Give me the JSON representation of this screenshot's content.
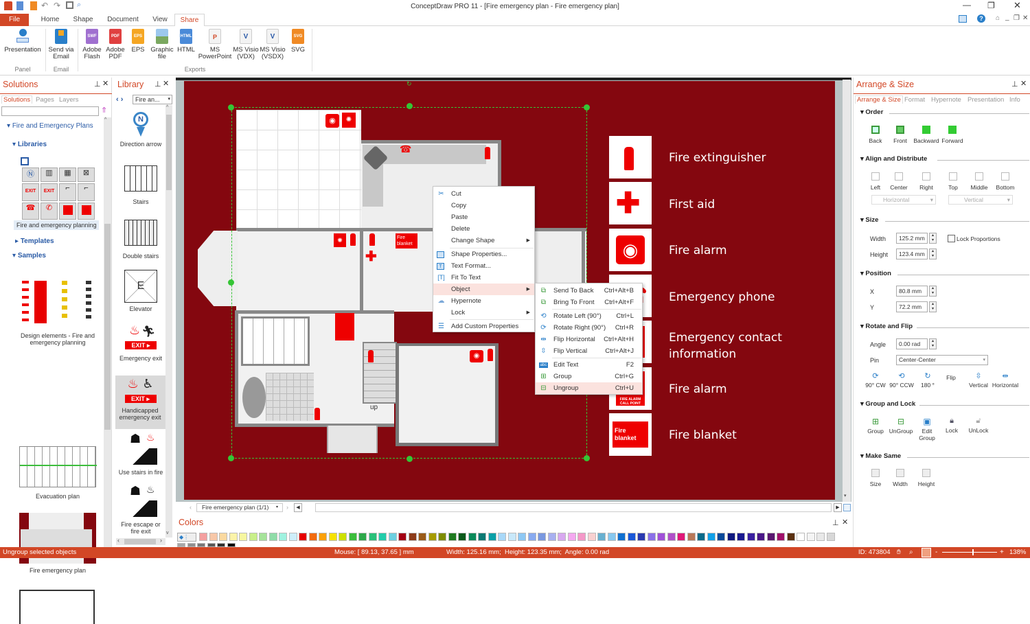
{
  "window": {
    "title": "ConceptDraw PRO 11 - [Fire emergency plan - Fire emergency plan]",
    "controls": [
      "minimize",
      "restore",
      "close"
    ]
  },
  "ribbon": {
    "tabs": [
      {
        "label": "File"
      },
      {
        "label": "Home"
      },
      {
        "label": "Shape"
      },
      {
        "label": "Document"
      },
      {
        "label": "View"
      },
      {
        "label": "Share",
        "active": true
      }
    ],
    "buttons": [
      {
        "label1": "Presentation",
        "label2": "",
        "icon": "presentation-icon",
        "color": "#2a7fc9"
      },
      {
        "label1": "Send via",
        "label2": "Email",
        "icon": "email-icon",
        "color": "#2a7fc9"
      },
      {
        "label1": "Adobe",
        "label2": "Flash",
        "icon": "swf-file-icon",
        "badge": "SWF",
        "color": "#a070d0"
      },
      {
        "label1": "Adobe",
        "label2": "PDF",
        "icon": "pdf-file-icon",
        "badge": "PDF",
        "color": "#e04040"
      },
      {
        "label1": "EPS",
        "label2": "",
        "icon": "eps-file-icon",
        "badge": "EPS",
        "color": "#f5a623"
      },
      {
        "label1": "Graphic",
        "label2": "file",
        "icon": "image-file-icon",
        "badge": "",
        "color": "#6aa0d8"
      },
      {
        "label1": "HTML",
        "label2": "",
        "icon": "html-file-icon",
        "badge": "HTML",
        "color": "#4a8ad8"
      },
      {
        "label1": "MS",
        "label2": "PowerPoint",
        "icon": "powerpoint-icon",
        "badge": "P",
        "color": "#d24726"
      },
      {
        "label1": "MS Visio",
        "label2": "(VDX)",
        "icon": "visio-vdx-icon",
        "badge": "V",
        "color": "#2b5aa8"
      },
      {
        "label1": "MS Visio",
        "label2": "(VSDX)",
        "icon": "visio-vsdx-icon",
        "badge": "V",
        "color": "#2b5aa8"
      },
      {
        "label1": "SVG",
        "label2": "",
        "icon": "svg-file-icon",
        "badge": "SVG",
        "color": "#f08a24"
      }
    ],
    "groups": [
      "Panel",
      "Email",
      "Exports"
    ]
  },
  "solutions": {
    "title": "Solutions",
    "tabs": [
      "Solutions",
      "Pages",
      "Layers"
    ],
    "search_value": "",
    "tree": {
      "root": "Fire and Emergency Plans",
      "libraries": "Libraries",
      "library_item": "Fire and emergency planning",
      "templates": "Templates",
      "samples": "Samples"
    },
    "samples": [
      {
        "label": "Design elements - Fire and emergency planning"
      },
      {
        "label": "Evacuation plan"
      },
      {
        "label": "Fire emergency plan"
      }
    ]
  },
  "library": {
    "title": "Library",
    "selector": "Fire an...",
    "items": [
      {
        "label": "Direction arrow",
        "icon": "direction-arrow-icon"
      },
      {
        "label": "Stairs",
        "icon": "stairs-icon"
      },
      {
        "label": "Double stairs",
        "icon": "double-stairs-icon"
      },
      {
        "label": "Elevator",
        "icon": "elevator-icon"
      },
      {
        "label": "Emergency exit",
        "icon": "emergency-exit-icon"
      },
      {
        "label": "Handicapped emergency exit",
        "icon": "handicapped-exit-icon",
        "selected": true
      },
      {
        "label": "Use stairs in fire",
        "icon": "use-stairs-icon"
      },
      {
        "label": "Fire escape or fire exit",
        "icon": "fire-escape-icon"
      }
    ]
  },
  "canvas": {
    "page_color": "#84070f",
    "floor_label": "up",
    "legend": [
      {
        "label": "Fire extinguisher",
        "icon": "fire-extinguisher-icon"
      },
      {
        "label": "First aid",
        "icon": "first-aid-icon"
      },
      {
        "label": "Fire alarm",
        "icon": "fire-alarm-icon"
      },
      {
        "label": "Emergency phone",
        "icon": "emergency-phone-icon"
      },
      {
        "label": "Emergency contact information",
        "icon": "emergency-contact-icon"
      },
      {
        "label": "Fire alarm",
        "icon": "fire-alarm-call-point-icon"
      },
      {
        "label": "Fire blanket",
        "icon": "fire-blanket-icon"
      }
    ],
    "blanket_text": "Fire blanket",
    "callpoint_text": "FIRE ALARM CALL POINT"
  },
  "context_menu": {
    "items": [
      {
        "label": "Cut",
        "icon": "scissors-icon"
      },
      {
        "label": "Copy"
      },
      {
        "label": "Paste"
      },
      {
        "label": "Delete"
      },
      {
        "label": "Change Shape",
        "submenu": true
      },
      {
        "label": "Shape Properties...",
        "icon": "shape-properties-icon"
      },
      {
        "label": "Text Format...",
        "icon": "text-format-icon"
      },
      {
        "label": "Fit To Text",
        "icon": "fit-to-text-icon"
      },
      {
        "label": "Object",
        "submenu": true,
        "highlighted": true
      },
      {
        "label": "Hypernote",
        "icon": "hypernote-icon"
      },
      {
        "label": "Lock",
        "submenu": true
      },
      {
        "label": "Add Custom Properties",
        "icon": "custom-properties-icon"
      }
    ],
    "submenu": [
      {
        "label": "Send To Back",
        "shortcut": "Ctrl+Alt+B",
        "icon": "send-to-back-icon"
      },
      {
        "label": "Bring To Front",
        "shortcut": "Ctrl+Alt+F",
        "icon": "bring-to-front-icon"
      },
      {
        "label": "Rotate Left (90°)",
        "shortcut": "Ctrl+L",
        "icon": "rotate-left-icon"
      },
      {
        "label": "Rotate Right (90°)",
        "shortcut": "Ctrl+R",
        "icon": "rotate-right-icon"
      },
      {
        "label": "Flip Horizontal",
        "shortcut": "Ctrl+Alt+H",
        "icon": "flip-horizontal-icon"
      },
      {
        "label": "Flip Vertical",
        "shortcut": "Ctrl+Alt+J",
        "icon": "flip-vertical-icon"
      },
      {
        "label": "Edit Text",
        "shortcut": "F2",
        "icon": "edit-text-icon"
      },
      {
        "label": "Group",
        "shortcut": "Ctrl+G",
        "icon": "group-icon"
      },
      {
        "label": "Ungroup",
        "shortcut": "Ctrl+U",
        "icon": "ungroup-icon",
        "highlighted": true
      }
    ]
  },
  "arrange": {
    "title": "Arrange & Size",
    "tabs": [
      "Arrange & Size",
      "Format",
      "Hypernote",
      "Presentation",
      "Info"
    ],
    "order": {
      "title": "Order",
      "buttons": [
        "Back",
        "Front",
        "Backward",
        "Forward"
      ]
    },
    "align": {
      "title": "Align and Distribute",
      "buttons": [
        "Left",
        "Center",
        "Right",
        "Top",
        "Middle",
        "Bottom"
      ],
      "horizontal": "Horizontal",
      "vertical": "Vertical"
    },
    "size": {
      "title": "Size",
      "width_label": "Width",
      "width": "125.2 mm",
      "height_label": "Height",
      "height": "123.4 mm",
      "lock_label": "Lock Proportions",
      "lock_checked": false
    },
    "position": {
      "title": "Position",
      "x_label": "X",
      "x": "80.8 mm",
      "y_label": "Y",
      "y": "72.2 mm"
    },
    "rotate": {
      "title": "Rotate and Flip",
      "angle_label": "Angle",
      "angle": "0.00 rad",
      "pin_label": "Pin",
      "pin": "Center-Center",
      "buttons": [
        "90° CW",
        "90° CCW",
        "180 °",
        "Flip",
        "Vertical",
        "Horizontal"
      ]
    },
    "group": {
      "title": "Group and Lock",
      "buttons": [
        "Group",
        "UnGroup",
        "Edit Group",
        "Lock",
        "UnLock"
      ]
    },
    "same": {
      "title": "Make Same",
      "buttons": [
        "Size",
        "Width",
        "Height"
      ]
    }
  },
  "pagenav": {
    "page": "Fire emergency plan (1/1)"
  },
  "colors": {
    "title": "Colors",
    "row1": [
      "#f4a0a0",
      "#f7c7a8",
      "#fad9a0",
      "#fbf3a8",
      "#f6f6a0",
      "#c9ef8a",
      "#a6e39a",
      "#8fdca8",
      "#9ff2e0",
      "#cdeefa",
      "#e60000",
      "#f26b0f",
      "#fba10a",
      "#f6e100",
      "#cde000",
      "#3cbd3c",
      "#2ea84a",
      "#2ac07a",
      "#22ccaa",
      "#6ccfe0",
      "#a30014",
      "#8c3b1a",
      "#9a5b19",
      "#a69b00",
      "#7e8c00",
      "#1f7a1f",
      "#0b5a1b",
      "#0a8a5a",
      "#0b7a74",
      "#0aa0a8",
      "#a8d8f8",
      "#c8e8fa",
      "#8ec8f4",
      "#88aaf0",
      "#7a98e0",
      "#a8b0f0",
      "#d8a8f0",
      "#f4a8f0",
      "#f498c8",
      "#f8d0d0",
      "#68b0d0",
      "#86c8f0",
      "#1070d0",
      "#1a58d8",
      "#2a3ab0",
      "#8a70e8",
      "#a050d8",
      "#b050c8",
      "#e01878",
      "#b87858",
      "#0a6a8a",
      "#10a0e8",
      "#0a4a9a",
      "#101a80",
      "#1a1a90",
      "#3a20a0",
      "#4a1888",
      "#5a1870",
      "#a0106a",
      "#5a3010",
      "#ffffff",
      "#f4f4f4",
      "#e8e8e8",
      "#d8d8d8"
    ],
    "row2": [
      "#a8a8a8",
      "#909090",
      "#787878",
      "#585858",
      "#303030",
      "#000000"
    ]
  },
  "status": {
    "message": "Ungroup selected objects",
    "mouse": "Mouse: [ 89.13, 37.65 ] mm",
    "dims": "Width: 125.16 mm;  Height: 123.35 mm;  Angle: 0.00 rad",
    "id": "ID: 473804",
    "zoom": "138%",
    "zoom_level": 0.55
  }
}
